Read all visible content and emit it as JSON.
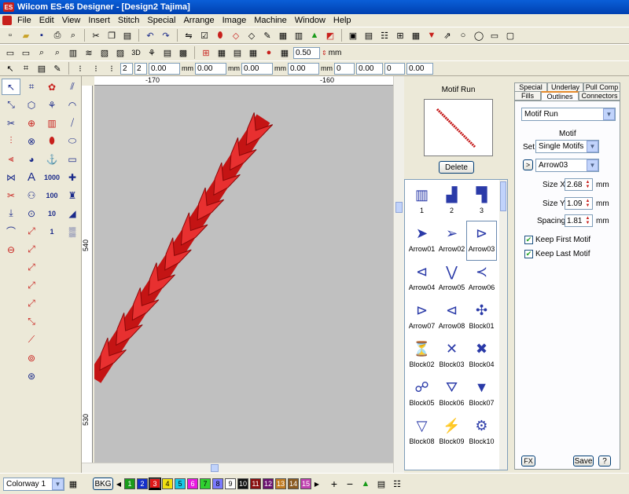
{
  "window": {
    "title": "Wilcom ES-65 Designer - [Design2        Tajima]",
    "logo_text": "ES"
  },
  "menu": [
    "File",
    "Edit",
    "View",
    "Insert",
    "Stitch",
    "Special",
    "Arrange",
    "Image",
    "Machine",
    "Window",
    "Help"
  ],
  "toolbar": {
    "zoom_value": "0.50",
    "zoom_unit": "mm",
    "field_a": "2",
    "field_b": "2",
    "unit": "mm",
    "field_zero": "0.00",
    "field_zero_b": "0"
  },
  "rulers": {
    "h_labels": [
      "-170",
      "-160"
    ],
    "v_labels": [
      "540",
      "530"
    ]
  },
  "preview": {
    "title": "Motif Run",
    "delete_label": "Delete"
  },
  "motif_list": {
    "items": [
      {
        "label": "1"
      },
      {
        "label": "2"
      },
      {
        "label": "3"
      },
      {
        "label": "Arrow01"
      },
      {
        "label": "Arrow02"
      },
      {
        "label": "Arrow03"
      },
      {
        "label": "Arrow04"
      },
      {
        "label": "Arrow05"
      },
      {
        "label": "Arrow06"
      },
      {
        "label": "Arrow07"
      },
      {
        "label": "Arrow08"
      },
      {
        "label": "Block01"
      },
      {
        "label": "Block02"
      },
      {
        "label": "Block03"
      },
      {
        "label": "Block04"
      },
      {
        "label": "Block05"
      },
      {
        "label": "Block06"
      },
      {
        "label": "Block07"
      },
      {
        "label": "Block08"
      },
      {
        "label": "Block09"
      },
      {
        "label": "Block10"
      }
    ],
    "selected": "Arrow03"
  },
  "props": {
    "tabs_top": [
      "Special",
      "Underlay",
      "Pull Comp"
    ],
    "tabs_bottom": [
      "Fills",
      "Outlines",
      "Connectors"
    ],
    "active_tab": "Outlines",
    "stitch_type": "Motif Run",
    "section_label": "Motif",
    "set_label": "Set",
    "set_value": "Single Motifs",
    "motif_value": "Arrow03",
    "size_x_label": "Size X",
    "size_x": "2.68",
    "size_y_label": "Size Y",
    "size_y": "1.09",
    "spacing_label": "Spacing",
    "spacing": "1.81",
    "unit": "mm",
    "keep_first": "Keep First Motif",
    "keep_last": "Keep Last Motif",
    "fx_label": "FX",
    "save_label": "Save",
    "help_label": "?"
  },
  "statusbar": {
    "colorway": "Colorway 1",
    "bkg": "BKG",
    "swatches": [
      {
        "n": "1",
        "c": "#1a9b1a"
      },
      {
        "n": "2",
        "c": "#1430c8"
      },
      {
        "n": "3",
        "c": "#e01818"
      },
      {
        "n": "4",
        "c": "#f0e010"
      },
      {
        "n": "5",
        "c": "#18c8e8"
      },
      {
        "n": "6",
        "c": "#e818e0"
      },
      {
        "n": "7",
        "c": "#30d030"
      },
      {
        "n": "8",
        "c": "#7a7aff"
      },
      {
        "n": "9",
        "c": "#ffffff"
      },
      {
        "n": "10",
        "c": "#101010"
      },
      {
        "n": "11",
        "c": "#8a1010"
      },
      {
        "n": "12",
        "c": "#6a1070"
      },
      {
        "n": "13",
        "c": "#c07a20"
      },
      {
        "n": "14",
        "c": "#8a5a20"
      },
      {
        "n": "15",
        "c": "#c040b0"
      }
    ]
  }
}
